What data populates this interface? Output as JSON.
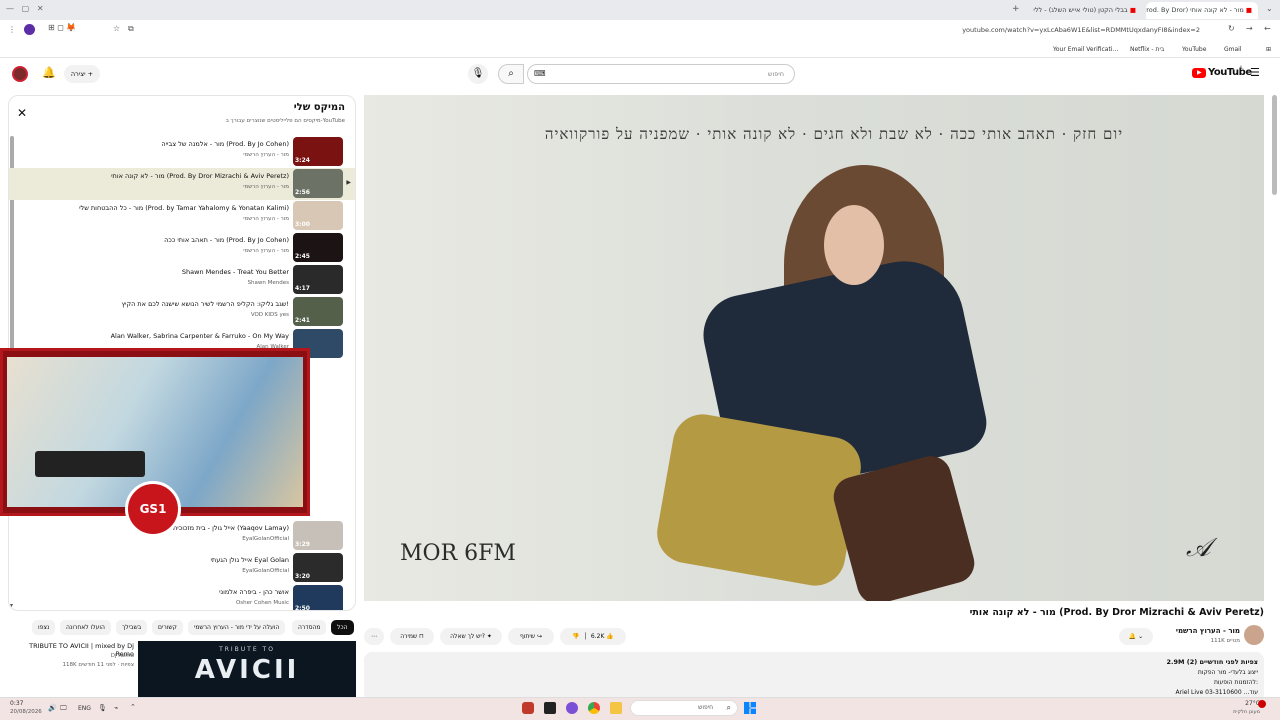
{
  "browser": {
    "tabs": [
      {
        "label": "מור - לא קונה אותי (Prod. By Dror"
      },
      {
        "label": "בבלי הקטן (טולי אייש השלג) - ללי"
      },
      {
        "label": "YouTube"
      }
    ],
    "url": "youtube.com/watch?v=yxLcAba6W1E&list=RDMMtUqxdanyFI8&index=2",
    "bookmarks": [
      "Your Email Verificati...",
      "Netflix - בית",
      "YouTube",
      "Gmail"
    ]
  },
  "yt": {
    "logo": "YouTube",
    "logo_sup": "IL",
    "search_placeholder": "חיפוש",
    "create_label": "יצירה"
  },
  "playlist": {
    "title": "המיקס שלי",
    "subtitle": "מיקסים הם פלייליסטים שנוצרים עבורך ב-YouTube",
    "items": [
      {
        "title": "מור - אלמנה של צבייה (Prod. By Jo Cohen)",
        "channel": "מור - הערוץ הרשמי",
        "duration": "3:24",
        "color": "#7a1212"
      },
      {
        "title": "מור - לא קונה אותי (Prod. By Dror Mizrachi & Aviv Peretz)",
        "channel": "מור - הערוץ הרשמי",
        "duration": "2:56",
        "color": "#6d7266"
      },
      {
        "title": "מור - כל ההבטחות שלי (Prod. by Tamar Yahalomy & Yonatan Kalimi)",
        "channel": "מור - הערוץ הרשמי",
        "duration": "3:00",
        "color": "#d9c7b5"
      },
      {
        "title": "מור - תאהב אותי ככה (Prod. By Jo Cohen)",
        "channel": "מור - הערוץ הרשמי",
        "duration": "2:45",
        "color": "#1c1414"
      },
      {
        "title": "Shawn Mendes - Treat You Better",
        "channel": "Shawn Mendes",
        "duration": "4:17",
        "color": "#2a2a2a"
      },
      {
        "title": "שגב גליקו: הקליפ הרשמי לשיר הנושא שישנה לכם את הקיץ!",
        "channel": "VOD KIDS yes",
        "duration": "2:41",
        "color": "#55604a"
      },
      {
        "title": "Alan Walker, Sabrina Carpenter & Farruko - On My Way",
        "channel": "Alan Walker",
        "duration": "3:3",
        "color": "#2e4a66"
      },
      {
        "title": "אייל גולן - בית מזכוכית (Yaaqov Lamay)",
        "channel": "EyalGolanOfficial",
        "duration": "3:29",
        "color": "#c7c0b8"
      },
      {
        "title": "אייל גולן הגעתי Eyal Golan",
        "channel": "EyalGolanOfficial",
        "duration": "3:20",
        "color": "#2b2b2b"
      },
      {
        "title": "אושר כהן - ביפרה אלמוני",
        "channel": "Osher Cohen Music",
        "duration": "2:50",
        "color": "#1f3a5c"
      }
    ]
  },
  "chips": [
    "הכל",
    "מהסדרה",
    "הועלה על ידי מור - הערוץ הרשמי",
    "קשורים",
    "בשבילך",
    "הועלו לאחרונה",
    "נצפו"
  ],
  "rec_video": {
    "title": "TRIBUTE TO AVICII | mixed by Dj Remo",
    "channel": "Dj Remo",
    "meta": "118K צפיות · לפני 11 חודשים",
    "thumb_text": "AVICII",
    "thumb_top": "TRIBUTE TO"
  },
  "player": {
    "song_strip": "יום חזק · תאהב אותי ככה · לא שבת ולא חגים · לא קונה אותי · שמפניה על פורקוואיה",
    "watermark": "MOR 6FM"
  },
  "video": {
    "title": "מור - לא קונה אותי (Prod. By Dror Mizrachi & Aviv Peretz)",
    "channel": "מור - הערוץ הרשמי",
    "subs": "111K מנויים",
    "likes": "6.2K",
    "share": "שיתוף",
    "ask": "יש לך שאלה?",
    "save": "שמירה",
    "desc_line1": "2.9M צפיות  לפני חודשיים (2)",
    "desc_line2": "ייצוג בלעדי- מור הפקות",
    "desc_line3": "להזמנות הופעות:",
    "desc_line4": "Ariel Live 03-3110600 ...עוד"
  },
  "taskbar": {
    "time": "0:37",
    "date": "20/08/2026",
    "lang": "ENG",
    "search": "חיפוש",
    "weather": "27°C",
    "weather_sub": "מעונן חלקית"
  },
  "overlay": {
    "badge": "GS1"
  }
}
